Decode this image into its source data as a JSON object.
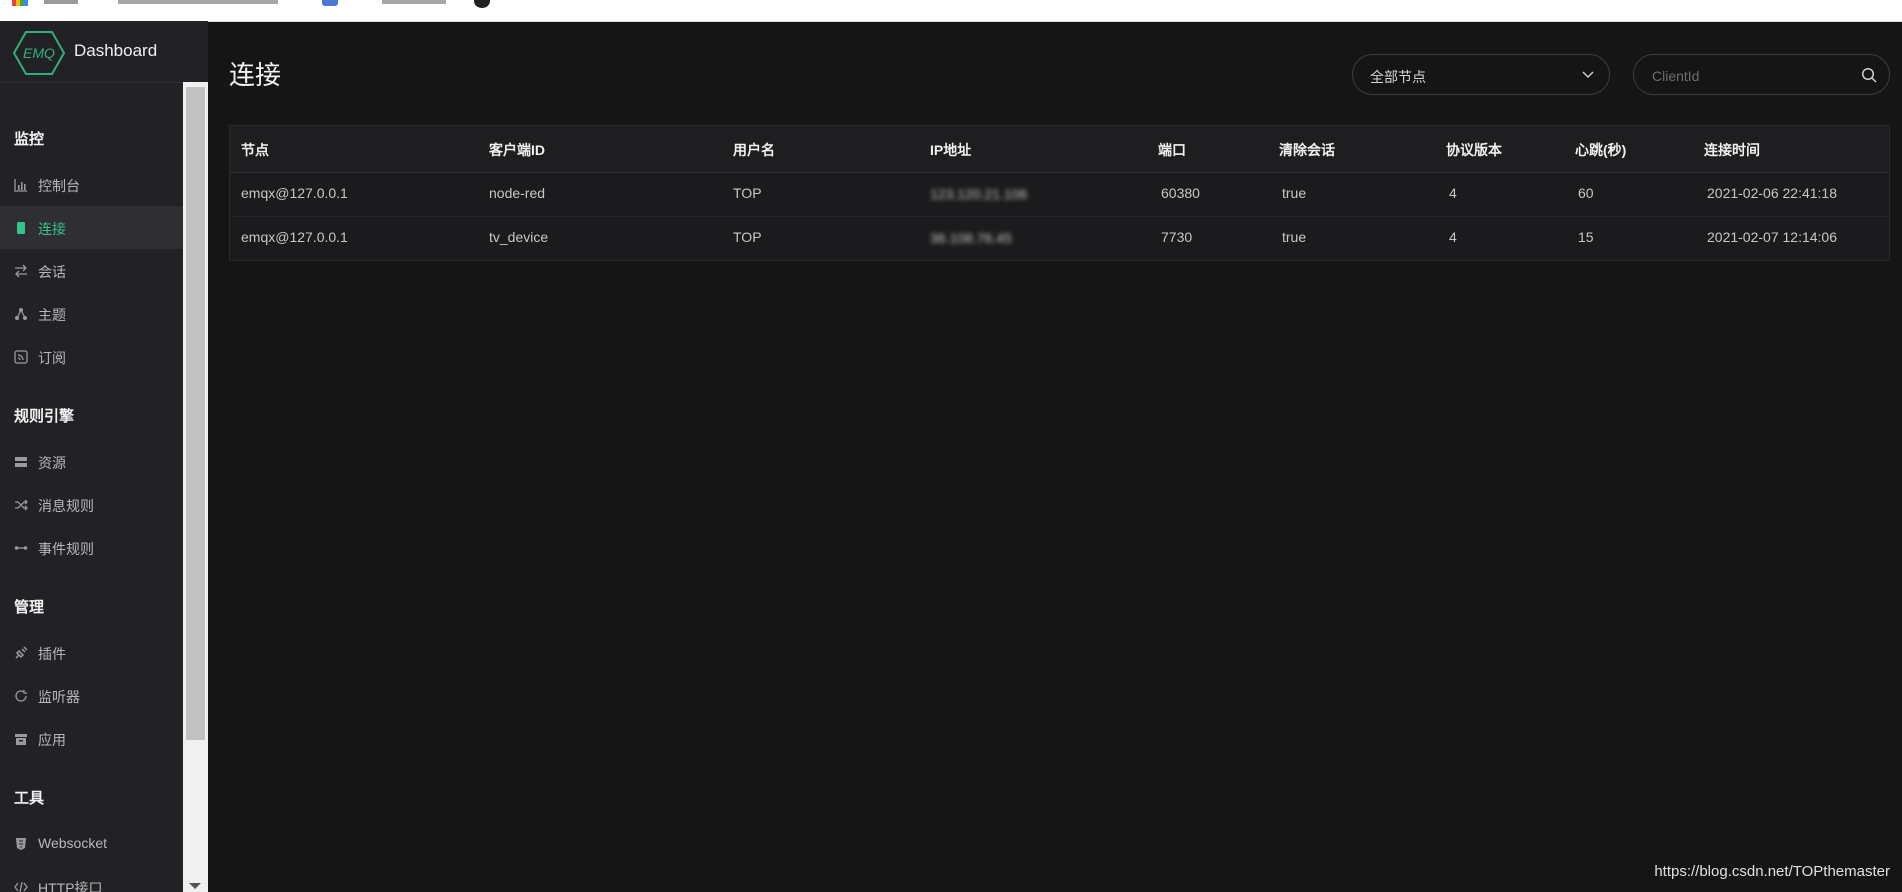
{
  "sidebar": {
    "logo_text": "Dashboard",
    "logo_badge": "EMQ",
    "groups": [
      {
        "title": "监控"
      },
      {
        "title": "规则引擎"
      },
      {
        "title": "管理"
      },
      {
        "title": "工具"
      }
    ],
    "items": [
      {
        "label": "控制台",
        "icon": "bar-chart-icon"
      },
      {
        "label": "连接",
        "icon": "device-icon",
        "active": true
      },
      {
        "label": "会话",
        "icon": "swap-arrows-icon"
      },
      {
        "label": "主题",
        "icon": "topic-icon"
      },
      {
        "label": "订阅",
        "icon": "rss-icon"
      },
      {
        "label": "资源",
        "icon": "server-icon"
      },
      {
        "label": "消息规则",
        "icon": "shuffle-icon"
      },
      {
        "label": "事件规则",
        "icon": "link-icon"
      },
      {
        "label": "插件",
        "icon": "plug-icon"
      },
      {
        "label": "监听器",
        "icon": "refresh-icon"
      },
      {
        "label": "应用",
        "icon": "archive-icon"
      },
      {
        "label": "Websocket",
        "icon": "html5-icon"
      },
      {
        "label": "HTTP接口",
        "icon": "code-icon"
      }
    ]
  },
  "main": {
    "title": "连接",
    "node_select": {
      "value": "全部节点"
    },
    "search": {
      "placeholder": "ClientId"
    }
  },
  "table": {
    "headers": [
      "节点",
      "客户端ID",
      "用户名",
      "IP地址",
      "端口",
      "清除会话",
      "协议版本",
      "心跳(秒)",
      "连接时间"
    ],
    "rows": [
      [
        "emqx@127.0.0.1",
        "node-red",
        "TOP",
        "123.120.21.106",
        "60380",
        "true",
        "4",
        "60",
        "2021-02-06 22:41:18"
      ],
      [
        "emqx@127.0.0.1",
        "tv_device",
        "TOP",
        "36.108.76.45",
        "7730",
        "true",
        "4",
        "15",
        "2021-02-07 12:14:06"
      ]
    ]
  },
  "watermark": "https://blog.csdn.net/TOPthemaster",
  "colors": {
    "accent": "#34c388",
    "background": "#151516",
    "sidebar": "#222226"
  }
}
